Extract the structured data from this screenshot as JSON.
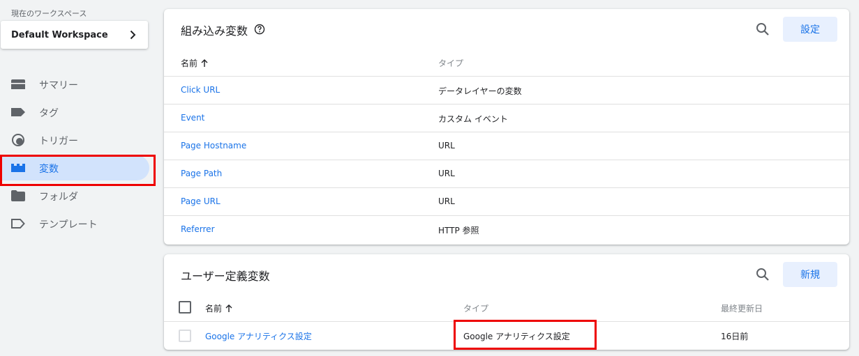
{
  "sidebar": {
    "workspace_label": "現在のワークスペース",
    "workspace_name": "Default Workspace",
    "items": [
      {
        "label": "サマリー",
        "icon": "summary-icon"
      },
      {
        "label": "タグ",
        "icon": "tag-icon"
      },
      {
        "label": "トリガー",
        "icon": "trigger-icon"
      },
      {
        "label": "変数",
        "icon": "variables-icon",
        "active": true
      },
      {
        "label": "フォルダ",
        "icon": "folder-icon"
      },
      {
        "label": "テンプレート",
        "icon": "template-icon"
      }
    ]
  },
  "builtin": {
    "title": "組み込み変数",
    "action_label": "設定",
    "col_name": "名前",
    "col_type": "タイプ",
    "rows": [
      {
        "name": "Click URL",
        "type": "データレイヤーの変数"
      },
      {
        "name": "Event",
        "type": "カスタム イベント"
      },
      {
        "name": "Page Hostname",
        "type": "URL"
      },
      {
        "name": "Page Path",
        "type": "URL"
      },
      {
        "name": "Page URL",
        "type": "URL"
      },
      {
        "name": "Referrer",
        "type": "HTTP 参照"
      }
    ]
  },
  "user_defined": {
    "title": "ユーザー定義変数",
    "action_label": "新規",
    "col_name": "名前",
    "col_type": "タイプ",
    "col_updated": "最終更新日",
    "rows": [
      {
        "name": "Google アナリティクス設定",
        "type": "Google アナリティクス設定",
        "updated": "16日前"
      }
    ]
  },
  "colors": {
    "accent": "#1a73e8",
    "active_bg": "#d2e3fc",
    "highlight": "#ee0000"
  }
}
